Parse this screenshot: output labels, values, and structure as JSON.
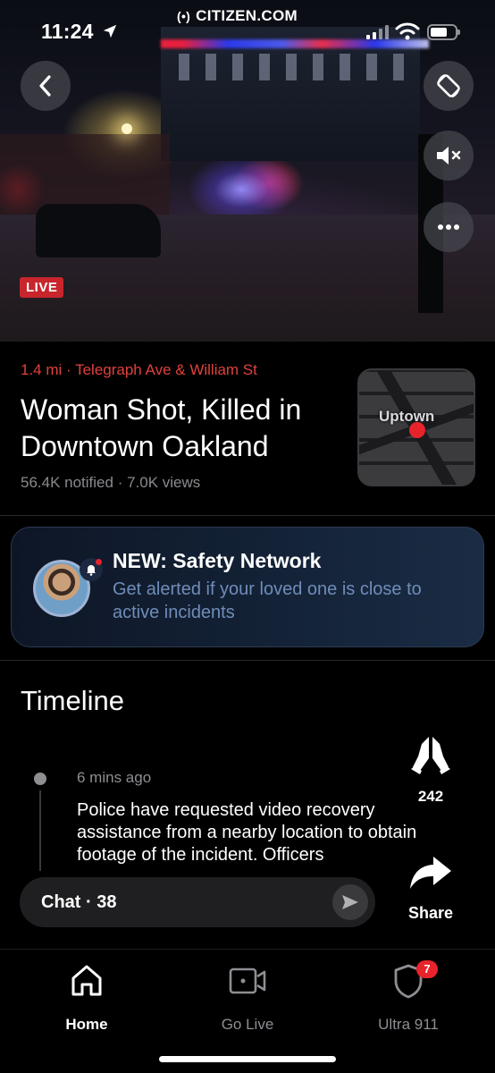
{
  "status_bar": {
    "time": "11:24",
    "brand": "CITIZEN.COM"
  },
  "video": {
    "live_label": "LIVE"
  },
  "incident": {
    "distance_location": "1.4 mi · Telegraph Ave & William St",
    "title": "Woman Shot, Killed in Downtown Oakland",
    "stats": "56.4K notified · 7.0K views",
    "map_label": "Uptown"
  },
  "promo": {
    "title": "NEW: Safety Network",
    "subtitle": "Get alerted if your loved one is close to active incidents"
  },
  "timeline": {
    "heading": "Timeline",
    "entries": [
      {
        "time": "6 mins ago",
        "text": "Police have requested video recovery assistance from a nearby location to obtain footage of the incident. Officers"
      }
    ]
  },
  "reactions": {
    "pray_count": "242",
    "share_label": "Share"
  },
  "chat": {
    "label": "Chat · 38"
  },
  "tabs": [
    {
      "label": "Home",
      "icon": "home-icon"
    },
    {
      "label": "Go Live",
      "icon": "video-camera-icon"
    },
    {
      "label": "Ultra 911",
      "icon": "shield-icon",
      "badge": "7"
    }
  ],
  "colors": {
    "accent_red": "#e0413c",
    "live_red": "#c8252d",
    "promo_text": "#6f8db8"
  }
}
